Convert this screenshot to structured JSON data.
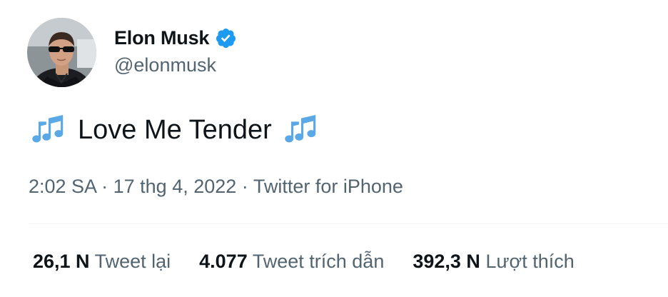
{
  "author": {
    "name": "Elon Musk",
    "handle": "@elonmusk",
    "verified_icon": "verified-badge-icon"
  },
  "tweet": {
    "text": "Love Me Tender",
    "leading_emoji": "multiple-musical-notes-icon",
    "trailing_emoji": "multiple-musical-notes-icon",
    "time": "2:02 SA",
    "separator": "·",
    "date": "17 thg 4, 2022",
    "source": "Twitter for iPhone"
  },
  "stats": {
    "retweets": {
      "count": "26,1 N",
      "label": "Tweet lại"
    },
    "quotes": {
      "count": "4.077",
      "label": "Tweet trích dẫn"
    },
    "likes": {
      "count": "392,3 N",
      "label": "Lượt thích"
    }
  },
  "colors": {
    "verified": "#1d9bf0",
    "text_primary": "#0f1419",
    "text_secondary": "#536471",
    "divider": "#eff3f4",
    "note_blue": "#5aa9e6"
  }
}
